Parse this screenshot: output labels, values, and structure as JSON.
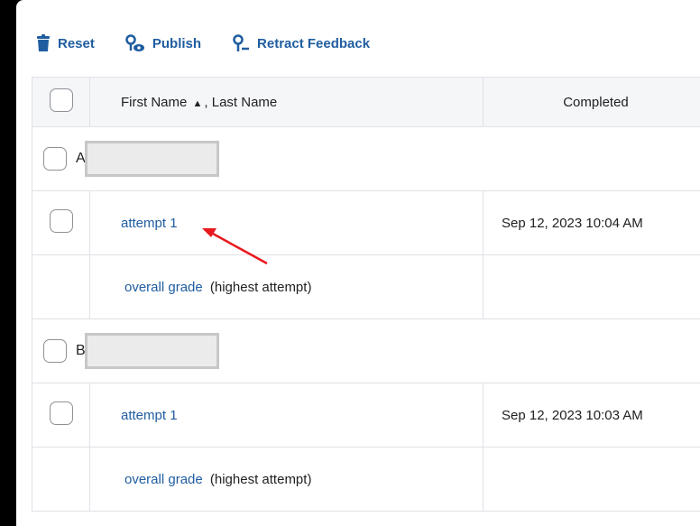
{
  "toolbar": {
    "reset_label": "Reset",
    "publish_label": "Publish",
    "retract_label": "Retract Feedback"
  },
  "table": {
    "headers": {
      "name_first": "First Name",
      "name_rest": ", Last Name",
      "completed": "Completed"
    },
    "groups": [
      {
        "initial": "Ar",
        "attempt_label": "attempt 1",
        "attempt_completed": "Sep 12, 2023 10:04 AM",
        "overall_link": "overall grade",
        "overall_note": "(highest attempt)"
      },
      {
        "initial": "Br",
        "attempt_label": "attempt 1",
        "attempt_completed": "Sep 12, 2023 10:03 AM",
        "overall_link": "overall grade",
        "overall_note": "(highest attempt)"
      }
    ]
  },
  "icons": {
    "reset": "trash-icon",
    "publish": "publish-icon",
    "retract": "retract-icon",
    "sort": "sort-ascending-icon"
  },
  "colors": {
    "link": "#1f5da0",
    "annotation_arrow": "#e8191e",
    "header_bg": "#f5f6f8"
  }
}
